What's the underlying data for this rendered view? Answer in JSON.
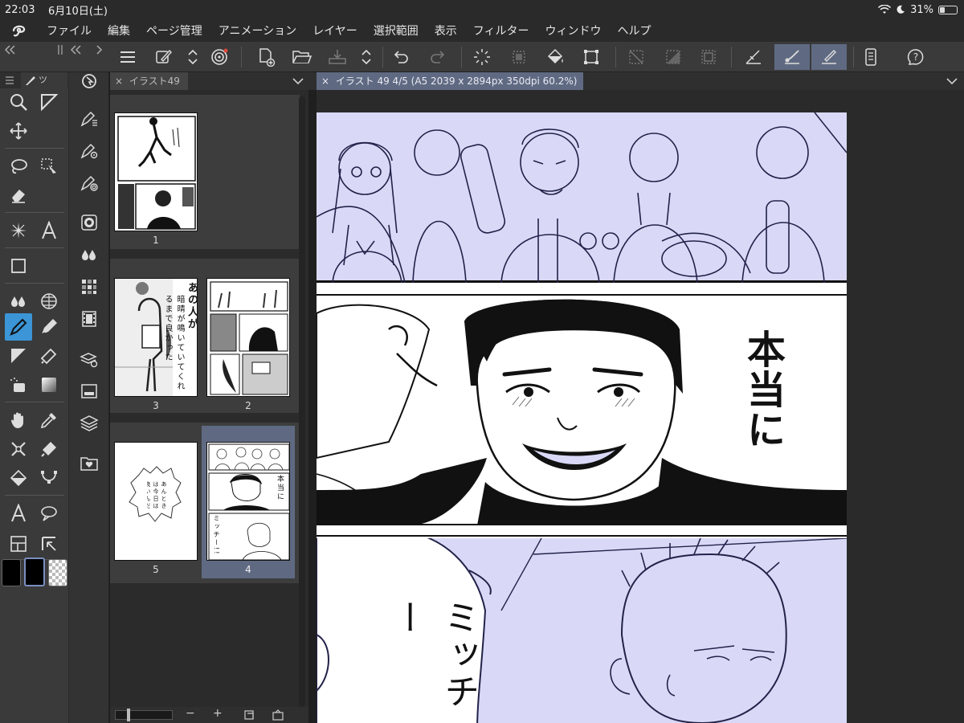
{
  "status_bar": {
    "time": "22:03",
    "date": "6月10日(土)",
    "battery_text": "31%",
    "battery_level": 0.31
  },
  "menu": [
    "ファイル",
    "編集",
    "ページ管理",
    "アニメーション",
    "レイヤー",
    "選択範囲",
    "表示",
    "フィルター",
    "ウィンドウ",
    "ヘルプ"
  ],
  "tool_palette": {
    "tab_label": "ツ"
  },
  "page_panel": {
    "tab_label": "イラスト49",
    "pages": [
      {
        "label": "1"
      },
      {
        "label": "3",
        "text_top": "あの人が",
        "text_body": "暗晴が鳴いていてくれるまで良かった"
      },
      {
        "label": "2"
      },
      {
        "label": "5",
        "text_body": "あんときは今日は良いんだ"
      },
      {
        "label": "4",
        "text_top": "本当に",
        "text_body": "ミッチー!!"
      }
    ],
    "zoom_minus": "−",
    "zoom_plus": "+"
  },
  "canvas": {
    "tab_label": "イラスト 49 4/5 (A5 2039 x 2894px 350dpi 60.2%)",
    "speech_1": "本当に",
    "speech_2": "ミッチー"
  },
  "colors": {
    "accent": "#3b95d6",
    "selection": "#5f6a82",
    "panel_tint": "#d9d9f7"
  }
}
